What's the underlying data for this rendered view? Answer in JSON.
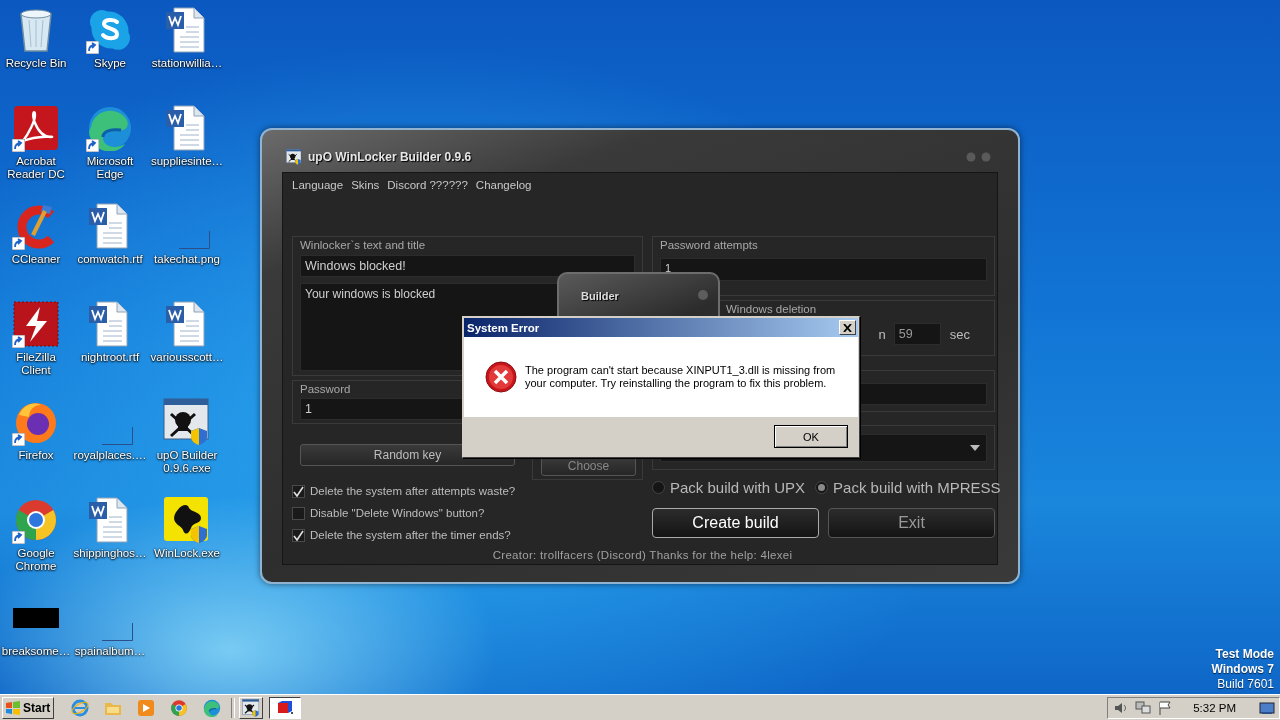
{
  "desktop_icons": [
    {
      "label": "Recycle Bin",
      "kind": "recycle-bin",
      "shortcut": false
    },
    {
      "label": "Acrobat Reader DC",
      "kind": "pdf-reader",
      "shortcut": true
    },
    {
      "label": "CCleaner",
      "kind": "ccleaner",
      "shortcut": true
    },
    {
      "label": "FileZilla Client",
      "kind": "filezilla",
      "shortcut": true
    },
    {
      "label": "Firefox",
      "kind": "firefox",
      "shortcut": true
    },
    {
      "label": "Google Chrome",
      "kind": "chrome",
      "shortcut": true
    },
    {
      "label": "breaksome…",
      "kind": "black-thumbnail",
      "shortcut": false
    },
    {
      "label": "Skype",
      "kind": "skype",
      "shortcut": true
    },
    {
      "label": "Microsoft Edge",
      "kind": "edge",
      "shortcut": true
    },
    {
      "label": "comwatch.rtf",
      "kind": "document",
      "shortcut": false
    },
    {
      "label": "nightroot.rtf",
      "kind": "document",
      "shortcut": false
    },
    {
      "label": "royalplaces.…",
      "kind": "blank",
      "shortcut": false
    },
    {
      "label": "shippinghos…",
      "kind": "document",
      "shortcut": false
    },
    {
      "label": "spainalbum…",
      "kind": "blank",
      "shortcut": false
    },
    {
      "label": "stationwillia…",
      "kind": "document",
      "shortcut": false
    },
    {
      "label": "suppliesinte…",
      "kind": "document",
      "shortcut": false
    },
    {
      "label": "takechat.png",
      "kind": "blank",
      "shortcut": false
    },
    {
      "label": "variousscott…",
      "kind": "document",
      "shortcut": false
    },
    {
      "label": "upO Builder 0.9.6.exe",
      "kind": "skull-app",
      "shortcut": false
    },
    {
      "label": "WinLock.exe",
      "kind": "winlock-app",
      "shortcut": false
    }
  ],
  "builder_window": {
    "title": "upO WinLocker Builder 0.9.6",
    "menu": [
      "Language",
      "Skins",
      "Discord ??????",
      "Changelog"
    ],
    "text_group": {
      "label": "Winlocker`s text and title",
      "title_value": "Windows blocked!",
      "text_value": "Your windows is blocked"
    },
    "password": {
      "label": "Password",
      "value": "1"
    },
    "random_key_button": "Random key",
    "choose_button": "Choose",
    "options": [
      {
        "label": "Delete the system after attempts waste?",
        "checked": true
      },
      {
        "label": "Disable \"Delete Windows\" button?",
        "checked": false
      },
      {
        "label": "Delete the system after the timer ends?",
        "checked": true
      }
    ],
    "attempts": {
      "label": "Password attempts",
      "value": "1"
    },
    "deletion": {
      "label": "Windows deletion",
      "label_fragment": "n",
      "value": "59",
      "unit": "sec"
    },
    "packers": [
      {
        "label": "Pack build with UPX",
        "selected": false
      },
      {
        "label": "Pack build with MPRESS",
        "selected": true
      }
    ],
    "create_button": "Create build",
    "exit_button": "Exit",
    "footer": "Creator: trollfacers (Discord) Thanks for the help: 4lexei"
  },
  "builder_dialog": {
    "title": "Builder"
  },
  "error_dialog": {
    "title": "System Error",
    "message": "The program can't start because XINPUT1_3.dll is missing from your computer. Try reinstalling the program to fix this problem.",
    "ok_button": "OK"
  },
  "taskbar": {
    "start": "Start",
    "quick_launch": [
      {
        "kind": "ie"
      },
      {
        "kind": "folder"
      },
      {
        "kind": "media"
      },
      {
        "kind": "chrome"
      },
      {
        "kind": "edge"
      }
    ],
    "tasks": [
      {
        "kind": "skull-app",
        "selected": false
      },
      {
        "kind": "red-app",
        "selected": true
      }
    ],
    "clock": "5:32 PM"
  },
  "os_notice": [
    {
      "text": "Test Mode",
      "bold": true
    },
    {
      "text": "Windows 7",
      "bold": true
    },
    {
      "text": "Build 7601",
      "bold": false
    }
  ]
}
